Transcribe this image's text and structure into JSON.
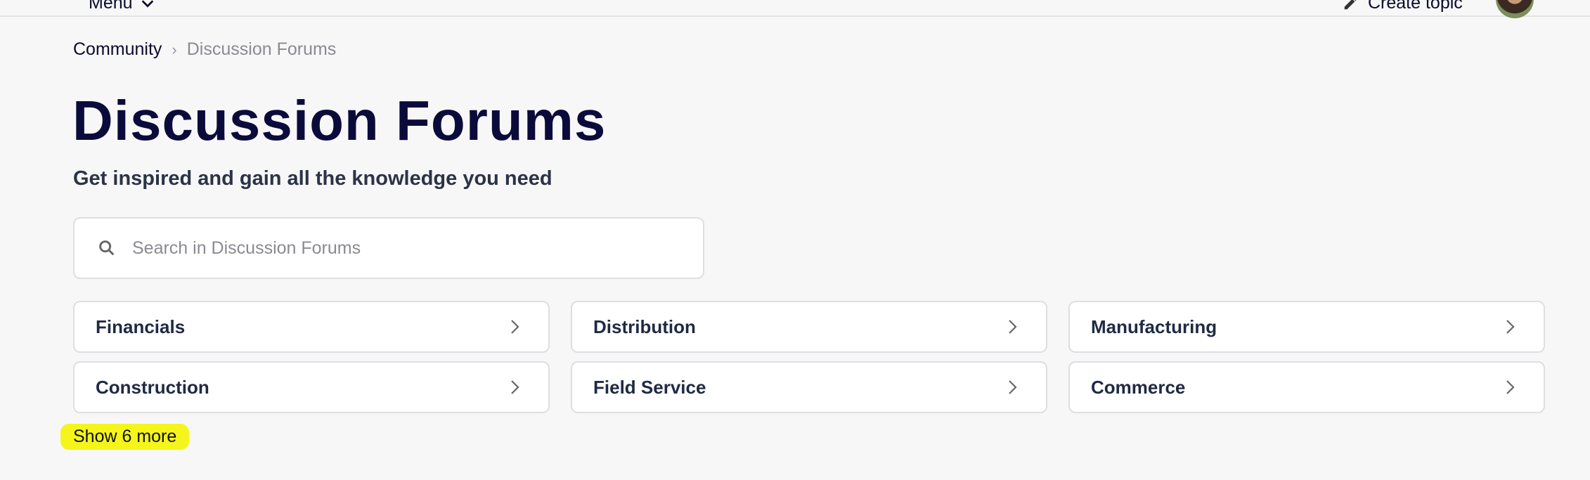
{
  "topbar": {
    "menu_label": "Menu",
    "create_topic_label": "Create topic"
  },
  "breadcrumb": {
    "parent": "Community",
    "current": "Discussion Forums"
  },
  "page": {
    "title": "Discussion Forums",
    "subtitle": "Get inspired and gain all the knowledge you need"
  },
  "search": {
    "placeholder": "Search in Discussion Forums",
    "value": ""
  },
  "categories": [
    {
      "label": "Financials"
    },
    {
      "label": "Distribution"
    },
    {
      "label": "Manufacturing"
    },
    {
      "label": "Construction"
    },
    {
      "label": "Field Service"
    },
    {
      "label": "Commerce"
    }
  ],
  "show_more_label": "Show 6 more",
  "icons": {
    "menu": "chevron-down-icon",
    "create": "pencil-icon",
    "search": "search-icon",
    "card": "chevron-right-icon"
  },
  "colors": {
    "title": "#0b0b3b",
    "highlight": "#f5f51c",
    "background": "#f7f7f7"
  }
}
